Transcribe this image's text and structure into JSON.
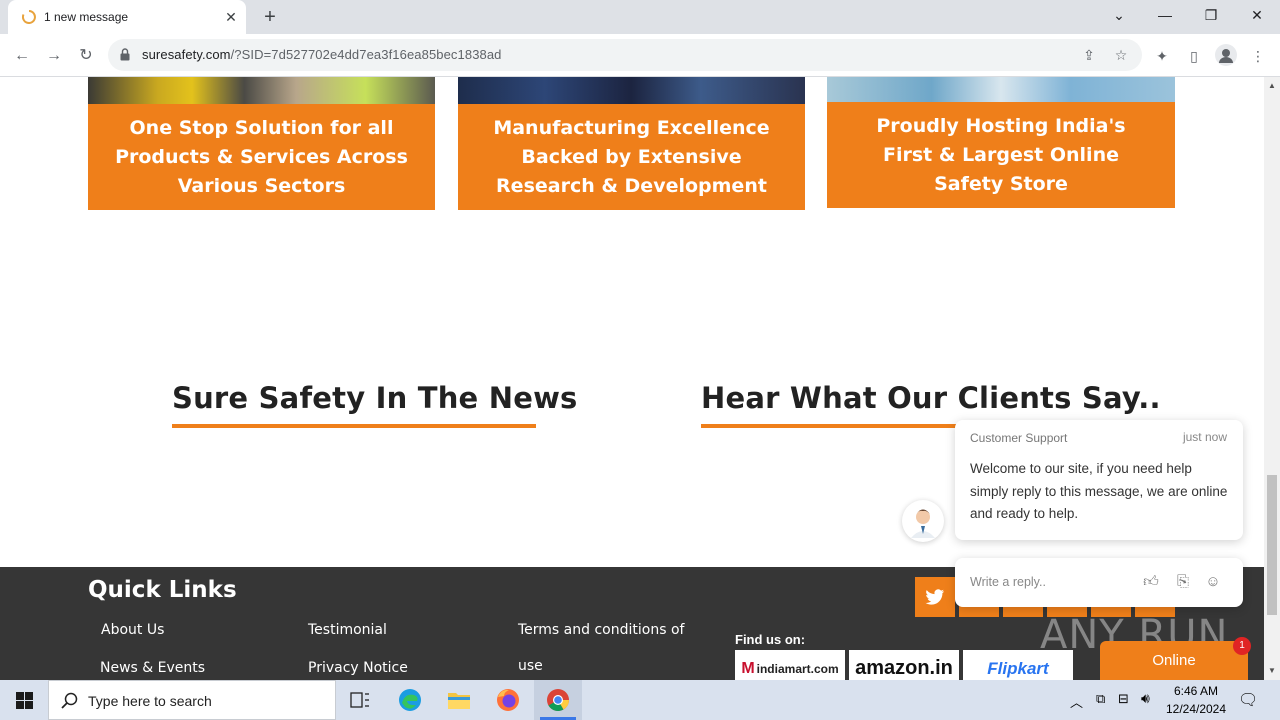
{
  "browser": {
    "tab_title": "1 new message",
    "url_host": "suresafety.com",
    "url_rest": "/?SID=7d527702e4dd7ea3f16ea85bec1838ad"
  },
  "cards": [
    {
      "text": "One Stop Solution for all Products & Services Across Various Sectors"
    },
    {
      "text": "Manufacturing Excellence Backed by Extensive Research & Development"
    },
    {
      "text": "Proudly Hosting India's First & Largest Online Safety Store"
    }
  ],
  "sections": {
    "news_title": "Sure Safety In The News",
    "clients_title": "Hear What Our Clients Say.."
  },
  "footer": {
    "quick_links_title": "Quick Links",
    "links": [
      "About Us",
      "Testimonial",
      "Terms and conditions of",
      "use",
      "News & Events",
      "Privacy Notice"
    ],
    "find_us": "Find us on:",
    "stores": [
      "indiamart.com",
      "amazon.in",
      "Flipkart"
    ]
  },
  "chat": {
    "sender": "Customer Support",
    "time": "just now",
    "message": "Welcome to our site, if you need help simply reply to this message, we are online and ready to help.",
    "reply_placeholder": "Write a reply..",
    "online_label": "Online",
    "badge_count": "1"
  },
  "watermark": "ANY RUN",
  "taskbar": {
    "search_placeholder": "Type here to search",
    "time": "6:46 AM",
    "date": "12/24/2024"
  },
  "colors": {
    "accent": "#ef7f1a",
    "footer_bg": "#363636"
  }
}
